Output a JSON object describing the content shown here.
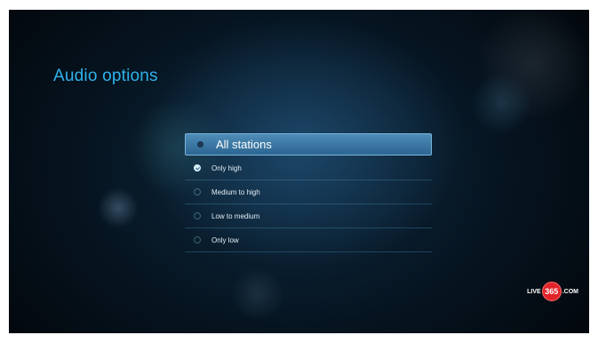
{
  "page": {
    "title": "Audio options"
  },
  "options": [
    {
      "label": "All stations",
      "state": "focused"
    },
    {
      "label": "Only high",
      "state": "checked"
    },
    {
      "label": "Medium to high",
      "state": "unchecked"
    },
    {
      "label": "Low to medium",
      "state": "unchecked"
    },
    {
      "label": "Only low",
      "state": "unchecked"
    }
  ],
  "logo": {
    "prefix": "LIVE",
    "number": "365",
    "suffix": ".COM"
  },
  "colors": {
    "title": "#2fb2ea",
    "highlight": "#3f7eab",
    "logo_badge": "#e0242a"
  }
}
